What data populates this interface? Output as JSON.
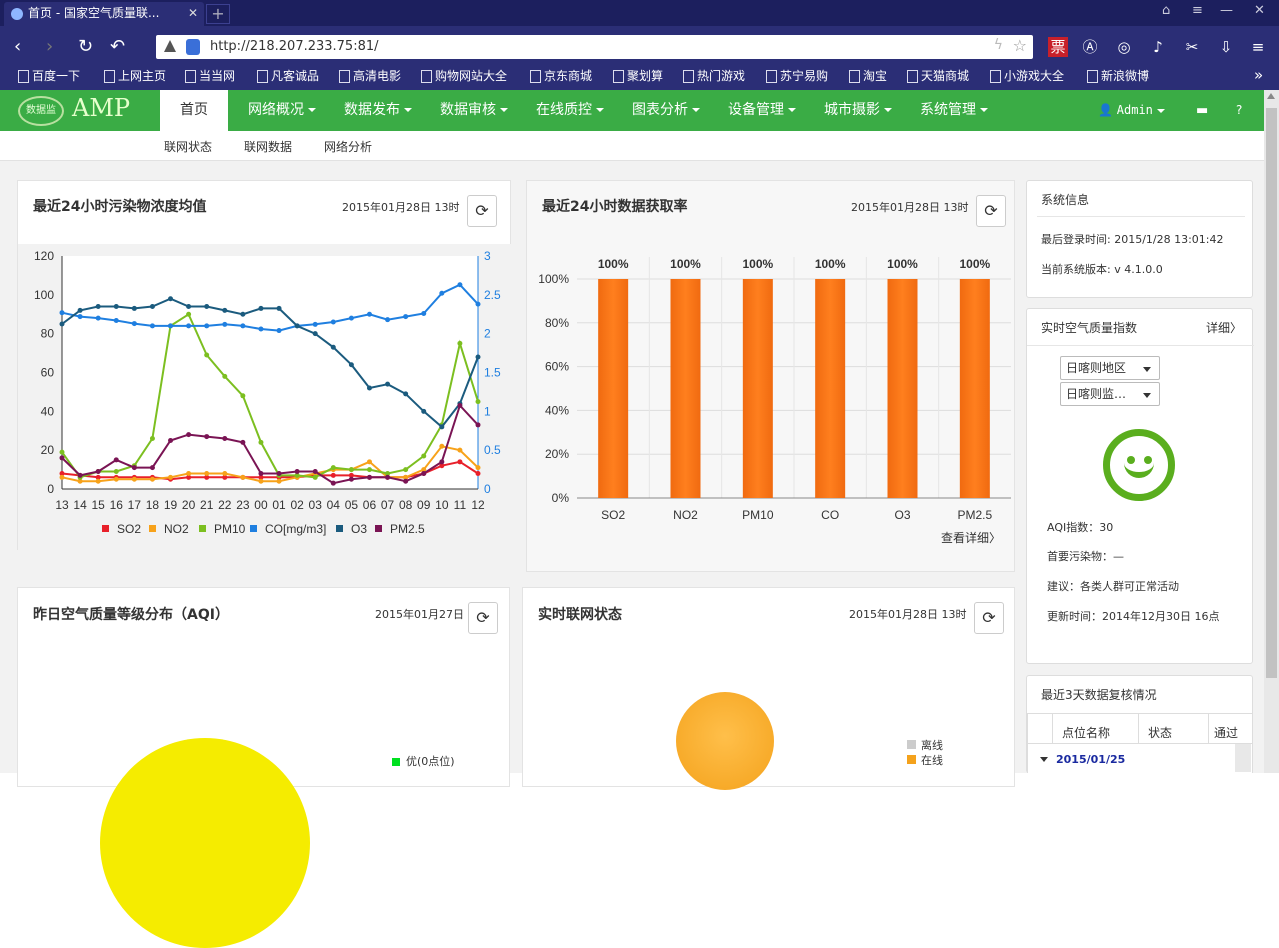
{
  "browser": {
    "tab_title": "首页 - 国家空气质量联...",
    "tab_close": "✕",
    "newtab": "+",
    "url": "http://218.207.233.75:81/",
    "bookmarks": [
      "百度一下",
      "上网主页",
      "当当网",
      "凡客诚品",
      "高清电影",
      "购物网站大全",
      "京东商城",
      "聚划算",
      "热门游戏",
      "苏宁易购",
      "淘宝",
      "天猫商城",
      "小游戏大全",
      "新浪微博"
    ],
    "bookmarks_more": "»"
  },
  "site": {
    "logo_text": "AMP",
    "logo_badge": "数据监",
    "nav": [
      {
        "label": "首页",
        "active": true
      },
      {
        "label": "网络概况"
      },
      {
        "label": "数据发布"
      },
      {
        "label": "数据审核"
      },
      {
        "label": "在线质控"
      },
      {
        "label": "图表分析"
      },
      {
        "label": "设备管理"
      },
      {
        "label": "城市摄影"
      },
      {
        "label": "系统管理"
      }
    ],
    "user": "Admin",
    "subnav": [
      "联网状态",
      "联网数据",
      "网络分析"
    ]
  },
  "panel_pollutants": {
    "title": "最近24小时污染物浓度均值",
    "date": "2015年01月28日 13时"
  },
  "panel_capture": {
    "title": "最近24小时数据获取率",
    "date": "2015年01月28日 13时",
    "more": "查看详细〉"
  },
  "panel_aqi_dist": {
    "title": "昨日空气质量等级分布（AQI）",
    "date": "2015年01月27日",
    "legend_first": "优(0点位)"
  },
  "panel_network": {
    "title": "实时联网状态",
    "date": "2015年01月28日 13时",
    "legend": [
      "离线",
      "在线"
    ]
  },
  "sys_info": {
    "title": "系统信息",
    "last_login": "最后登录时间: 2015/1/28 13:01:42",
    "version": "当前系统版本: v 4.1.0.0"
  },
  "aqi_now": {
    "title": "实时空气质量指数",
    "more": "详细〉",
    "select_region": "日喀则地区",
    "select_station": "日喀则监…",
    "aqi": "AQI指数：30",
    "primary": "首要污染物：—",
    "advice": "建议：各类人群可正常活动",
    "updated": "更新时间：2014年12月30日 16点"
  },
  "review": {
    "title": "最近3天数据复核情况",
    "headers": [
      "点位名称",
      "状态",
      "通过"
    ],
    "group": "2015/01/25"
  },
  "colors": {
    "green": "#3aac45",
    "bar": "#ff7f1e",
    "so2": "#e8202a",
    "no2": "#f7a21a",
    "pm10": "#7cbf20",
    "co": "#1f7fe0",
    "o3": "#1b5b7e",
    "pm25": "#7a1454"
  },
  "chart_data": [
    {
      "type": "line",
      "x": [
        "13",
        "14",
        "15",
        "16",
        "17",
        "18",
        "19",
        "20",
        "21",
        "22",
        "23",
        "00",
        "01",
        "02",
        "03",
        "04",
        "05",
        "06",
        "07",
        "08",
        "09",
        "10",
        "11",
        "12"
      ],
      "ylim": [
        0,
        120
      ],
      "y2lim": [
        0,
        3
      ],
      "yticks": [
        "120",
        "100",
        "80",
        "60",
        "40",
        "20",
        "0"
      ],
      "y2ticks": [
        "3",
        "2.5",
        "2",
        "1.5",
        "1",
        "0.5",
        "0"
      ],
      "series": [
        {
          "name": "SO2",
          "axis": "left",
          "values": [
            8,
            7,
            6,
            6,
            6,
            6,
            5,
            6,
            6,
            6,
            6,
            6,
            6,
            6,
            7,
            7,
            7,
            6,
            6,
            6,
            8,
            12,
            14,
            8
          ]
        },
        {
          "name": "NO2",
          "axis": "left",
          "values": [
            6,
            4,
            4,
            5,
            5,
            5,
            6,
            8,
            8,
            8,
            6,
            4,
            4,
            6,
            8,
            10,
            10,
            14,
            6,
            6,
            10,
            22,
            20,
            11
          ]
        },
        {
          "name": "PM10",
          "axis": "left",
          "values": [
            19,
            6,
            9,
            9,
            12,
            26,
            84,
            90,
            69,
            58,
            48,
            24,
            7,
            7,
            6,
            11,
            10,
            10,
            8,
            10,
            17,
            33,
            75,
            45
          ]
        },
        {
          "name": "CO[mg/m3]",
          "axis": "right",
          "values": [
            2.27,
            2.22,
            2.2,
            2.17,
            2.13,
            2.1,
            2.1,
            2.1,
            2.1,
            2.12,
            2.1,
            2.06,
            2.04,
            2.1,
            2.12,
            2.15,
            2.2,
            2.25,
            2.18,
            2.22,
            2.26,
            2.52,
            2.63,
            2.38
          ]
        },
        {
          "name": "O3",
          "axis": "left",
          "values": [
            85,
            92,
            94,
            94,
            93,
            94,
            98,
            94,
            94,
            92,
            90,
            93,
            93,
            84,
            80,
            73,
            64,
            52,
            54,
            49,
            40,
            32,
            44,
            68
          ]
        },
        {
          "name": "PM2.5",
          "axis": "left",
          "values": [
            16,
            7,
            9,
            15,
            11,
            11,
            25,
            28,
            27,
            26,
            24,
            8,
            8,
            9,
            9,
            3,
            5,
            6,
            6,
            4,
            8,
            14,
            43,
            33
          ]
        }
      ]
    },
    {
      "type": "bar",
      "categories": [
        "SO2",
        "NO2",
        "PM10",
        "CO",
        "O3",
        "PM2.5"
      ],
      "values": [
        100,
        100,
        100,
        100,
        100,
        100
      ],
      "labels": [
        "100%",
        "100%",
        "100%",
        "100%",
        "100%",
        "100%"
      ],
      "ylim": [
        0,
        100
      ],
      "yticks": [
        "100%",
        "80%",
        "60%",
        "40%",
        "20%",
        "0%"
      ]
    }
  ]
}
